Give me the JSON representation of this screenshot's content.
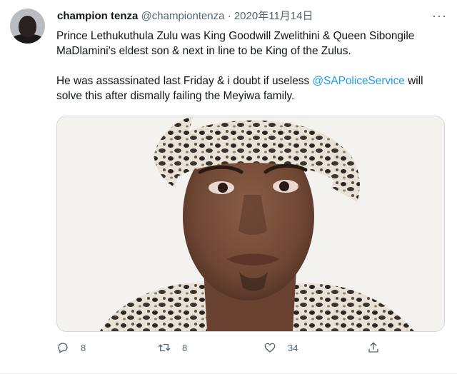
{
  "tweet": {
    "author_name": "champion tenza",
    "author_handle": "@championtenza",
    "separator": "·",
    "date": "2020年11月14日",
    "more_icon": "more-horizontal-icon",
    "paragraph_1": "Prince Lethukuthula Zulu was King Goodwill Zwelithini & Queen Sibongile MaDlamini's eldest son & next in line to be King of the Zulus.",
    "paragraph_2_before": "He was assassinated last Friday & i doubt if useless ",
    "mention": "@SAPoliceService",
    "paragraph_2_after": " will solve this after dismally failing the Meyiwa family.",
    "link_color": "#1d9bf0"
  },
  "actions": {
    "reply_count": "8",
    "retweet_count": "8",
    "like_count": "34",
    "reply_icon": "reply-icon",
    "retweet_icon": "retweet-icon",
    "like_icon": "heart-icon",
    "share_icon": "share-icon"
  }
}
